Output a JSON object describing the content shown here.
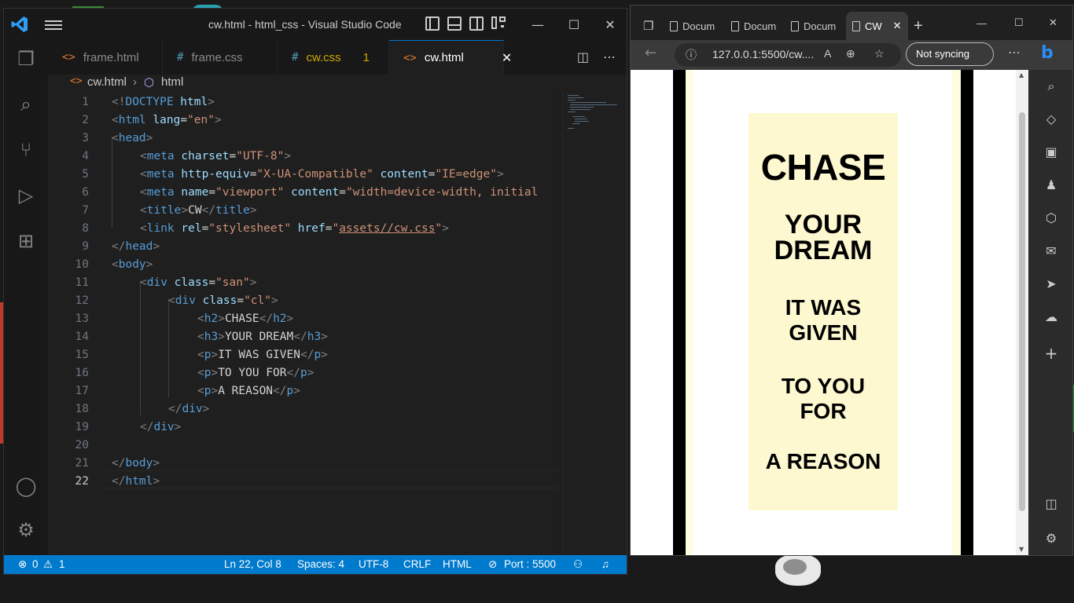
{
  "vscode": {
    "title": "cw.html - html_css - Visual Studio Code",
    "tabs": [
      {
        "label": "frame.html",
        "icon": "<>"
      },
      {
        "label": "frame.css",
        "icon": "#"
      },
      {
        "label": "cw.css",
        "icon": "#",
        "problems": "1"
      },
      {
        "label": "cw.html",
        "icon": "<>"
      }
    ],
    "breadcrumb": [
      "cw.html",
      "html"
    ],
    "line_numbers": [
      "1",
      "2",
      "3",
      "4",
      "5",
      "6",
      "7",
      "8",
      "9",
      "10",
      "11",
      "12",
      "13",
      "14",
      "15",
      "16",
      "17",
      "18",
      "19",
      "20",
      "21",
      "22"
    ],
    "code": {
      "l1_open": "<!",
      "l1_kw": "DOCTYPE",
      "l1_rest": " html",
      "l1_close": ">",
      "l2_open": "<",
      "l2_tag": "html",
      "l2_attr": " lang",
      "l2_eq": "=",
      "l2_val": "\"en\"",
      "l2_close": ">",
      "l3_open": "<",
      "l3_tag": "head",
      "l3_close": ">",
      "l4_open": "<",
      "l4_tag": "meta",
      "l4_attr": " charset",
      "l4_eq": "=",
      "l4_val": "\"UTF-8\"",
      "l4_close": ">",
      "l5_open": "<",
      "l5_tag": "meta",
      "l5_attr1": " http-equiv",
      "l5_eq1": "=",
      "l5_val1": "\"X-UA-Compatible\"",
      "l5_attr2": " content",
      "l5_eq2": "=",
      "l5_val2": "\"IE=edge\"",
      "l5_close": ">",
      "l6_open": "<",
      "l6_tag": "meta",
      "l6_attr1": " name",
      "l6_eq1": "=",
      "l6_val1": "\"viewport\"",
      "l6_attr2": " content",
      "l6_eq2": "=",
      "l6_val2": "\"width=device-width, initial",
      "l7_open": "<",
      "l7_tag": "title",
      "l7_close": ">",
      "l7_text": "CW",
      "l7_end_open": "</",
      "l7_end_tag": "title",
      "l7_end_close": ">",
      "l8_open": "<",
      "l8_tag": "link",
      "l8_attr1": " rel",
      "l8_eq1": "=",
      "l8_val1": "\"stylesheet\"",
      "l8_attr2": " href",
      "l8_eq2": "=",
      "l8_q1": "\"",
      "l8_href": "assets//cw.css",
      "l8_q2": "\"",
      "l8_close": ">",
      "l9_open": "</",
      "l9_tag": "head",
      "l9_close": ">",
      "l10_open": "<",
      "l10_tag": "body",
      "l10_close": ">",
      "l11_open": "<",
      "l11_tag": "div",
      "l11_attr": " class",
      "l11_eq": "=",
      "l11_val": "\"san\"",
      "l11_close": ">",
      "l12_open": "<",
      "l12_tag": "div",
      "l12_attr": " class",
      "l12_eq": "=",
      "l12_val": "\"cl\"",
      "l12_close": ">",
      "l13_open": "<",
      "l13_tag": "h2",
      "l13_close": ">",
      "l13_text": "CHASE",
      "l13_end_open": "</",
      "l13_end_tag": "h2",
      "l13_end_close": ">",
      "l14_open": "<",
      "l14_tag": "h3",
      "l14_close": ">",
      "l14_text": "YOUR DREAM",
      "l14_end_open": "</",
      "l14_end_tag": "h3",
      "l14_end_close": ">",
      "l15_open": "<",
      "l15_tag": "p",
      "l15_close": ">",
      "l15_text": "IT WAS GIVEN",
      "l15_end_open": "</",
      "l15_end_tag": "p",
      "l15_end_close": ">",
      "l16_open": "<",
      "l16_tag": "p",
      "l16_close": ">",
      "l16_text": "TO YOU FOR",
      "l16_end_open": "</",
      "l16_end_tag": "p",
      "l16_end_close": ">",
      "l17_open": "<",
      "l17_tag": "p",
      "l17_close": ">",
      "l17_text": "A REASON",
      "l17_end_open": "</",
      "l17_end_tag": "p",
      "l17_end_close": ">",
      "l18_open": "</",
      "l18_tag": "div",
      "l18_close": ">",
      "l19_open": "</",
      "l19_tag": "div",
      "l19_close": ">",
      "l21_open": "</",
      "l21_tag": "body",
      "l21_close": ">",
      "l22_open": "</",
      "l22_tag": "html",
      "l22_close": ">"
    },
    "status": {
      "errors": "0",
      "warnings": "1",
      "position": "Ln 22, Col 8",
      "spaces": "Spaces: 4",
      "encoding": "UTF-8",
      "eol": "CRLF",
      "language": "HTML",
      "port": "Port : 5500"
    },
    "colors": {
      "accent": "#007acc",
      "tag": "#569cd6",
      "attr": "#9cdcfe",
      "string": "#ce9178"
    }
  },
  "browser": {
    "tabs": [
      "Docum",
      "Docum",
      "Docum",
      "CW"
    ],
    "url": "127.0.0.1:5500/cw....",
    "sync": "Not syncing",
    "page": {
      "h2": "CHASE",
      "h3_line1": "YOUR",
      "h3_line2": "DREAM",
      "p1_line1": "IT WAS",
      "p1_line2": "GIVEN",
      "p2_line1": "TO YOU",
      "p2_line2": "FOR",
      "p3": "A REASON"
    }
  }
}
